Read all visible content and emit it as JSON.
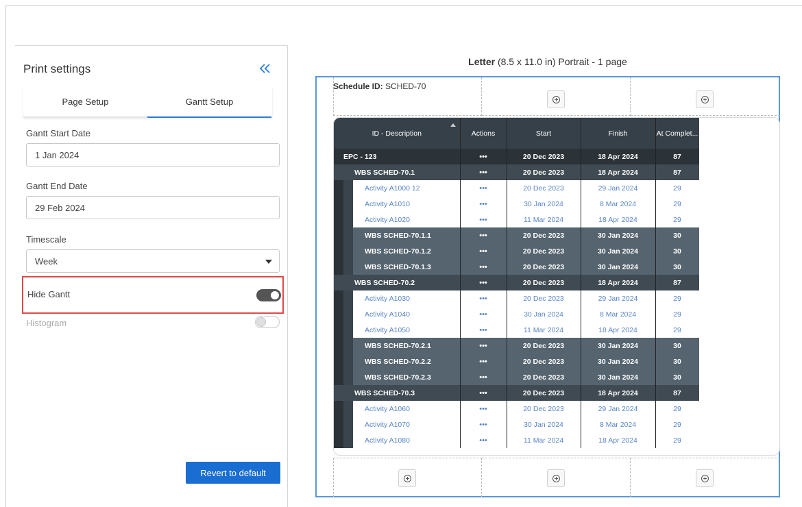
{
  "panel": {
    "title": "Print settings",
    "tabs": [
      "Page Setup",
      "Gantt Setup"
    ],
    "active_tab": "Gantt Setup",
    "gantt_start_label": "Gantt Start Date",
    "gantt_start_value": "1 Jan 2024",
    "gantt_end_label": "Gantt End Date",
    "gantt_end_value": "29 Feb 2024",
    "timescale_label": "Timescale",
    "timescale_value": "Week",
    "hide_gantt_label": "Hide Gantt",
    "hide_gantt_on": true,
    "histogram_label": "Histogram",
    "histogram_on": false,
    "revert_label": "Revert to default"
  },
  "preview": {
    "paper_bold": "Letter",
    "paper_rest": " (8.5 x 11.0 in) Portrait - 1 page",
    "schedule_key": "Schedule ID:",
    "schedule_value": " SCHED-70"
  },
  "table": {
    "headers": [
      "ID - Description",
      "Actions",
      "Start",
      "Finish",
      "At Complet..."
    ],
    "rows": [
      {
        "level": "lvl0",
        "id": "EPC - 123",
        "start": "20 Dec 2023",
        "finish": "18 Apr 2024",
        "complete": "87"
      },
      {
        "level": "lvl1",
        "id": "WBS SCHED-70.1",
        "start": "20 Dec 2023",
        "finish": "18 Apr 2024",
        "complete": "87"
      },
      {
        "level": "act",
        "id": "Activity A1000 12",
        "start": "20 Dec 2023",
        "finish": "29 Jan 2024",
        "complete": "29"
      },
      {
        "level": "act",
        "id": "Activity A1010",
        "start": "30 Jan 2024",
        "finish": "8 Mar 2024",
        "complete": "29"
      },
      {
        "level": "act",
        "id": "Activity A1020",
        "start": "11 Mar 2024",
        "finish": "18 Apr 2024",
        "complete": "29"
      },
      {
        "level": "wbs2",
        "id": "WBS SCHED-70.1.1",
        "start": "20 Dec 2023",
        "finish": "30 Jan 2024",
        "complete": "30"
      },
      {
        "level": "wbs2",
        "id": "WBS SCHED-70.1.2",
        "start": "20 Dec 2023",
        "finish": "30 Jan 2024",
        "complete": "30"
      },
      {
        "level": "wbs2",
        "id": "WBS SCHED-70.1.3",
        "start": "20 Dec 2023",
        "finish": "30 Jan 2024",
        "complete": "30"
      },
      {
        "level": "lvl1",
        "id": "WBS SCHED-70.2",
        "start": "20 Dec 2023",
        "finish": "18 Apr 2024",
        "complete": "87"
      },
      {
        "level": "act",
        "id": "Activity A1030",
        "start": "20 Dec 2023",
        "finish": "29 Jan 2024",
        "complete": "29"
      },
      {
        "level": "act",
        "id": "Activity A1040",
        "start": "30 Jan 2024",
        "finish": "8 Mar 2024",
        "complete": "29"
      },
      {
        "level": "act",
        "id": "Activity A1050",
        "start": "11 Mar 2024",
        "finish": "18 Apr 2024",
        "complete": "29"
      },
      {
        "level": "wbs2",
        "id": "WBS SCHED-70.2.1",
        "start": "20 Dec 2023",
        "finish": "30 Jan 2024",
        "complete": "30"
      },
      {
        "level": "wbs2",
        "id": "WBS SCHED-70.2.2",
        "start": "20 Dec 2023",
        "finish": "30 Jan 2024",
        "complete": "30"
      },
      {
        "level": "wbs2",
        "id": "WBS SCHED-70.2.3",
        "start": "20 Dec 2023",
        "finish": "30 Jan 2024",
        "complete": "30"
      },
      {
        "level": "lvl1",
        "id": "WBS SCHED-70.3",
        "start": "20 Dec 2023",
        "finish": "18 Apr 2024",
        "complete": "87"
      },
      {
        "level": "act",
        "id": "Activity A1060",
        "start": "20 Dec 2023",
        "finish": "29 Jan 2024",
        "complete": "29"
      },
      {
        "level": "act",
        "id": "Activity A1070",
        "start": "30 Jan 2024",
        "finish": "8 Mar 2024",
        "complete": "29"
      },
      {
        "level": "act",
        "id": "Activity A1080",
        "start": "11 Mar 2024",
        "finish": "18 Apr 2024",
        "complete": "29"
      }
    ],
    "actions_glyph": "•••"
  },
  "colors": {
    "accent": "#1a6dd1",
    "tab_underline": "#2a7ad9",
    "highlight_border": "#e04a4a",
    "page_border": "#5b97d8",
    "activity_text": "#5a86c9"
  },
  "icons": {
    "collapse": "double-chevron-left-icon",
    "add": "plus-circle-icon",
    "dropdown": "caret-down-icon"
  }
}
